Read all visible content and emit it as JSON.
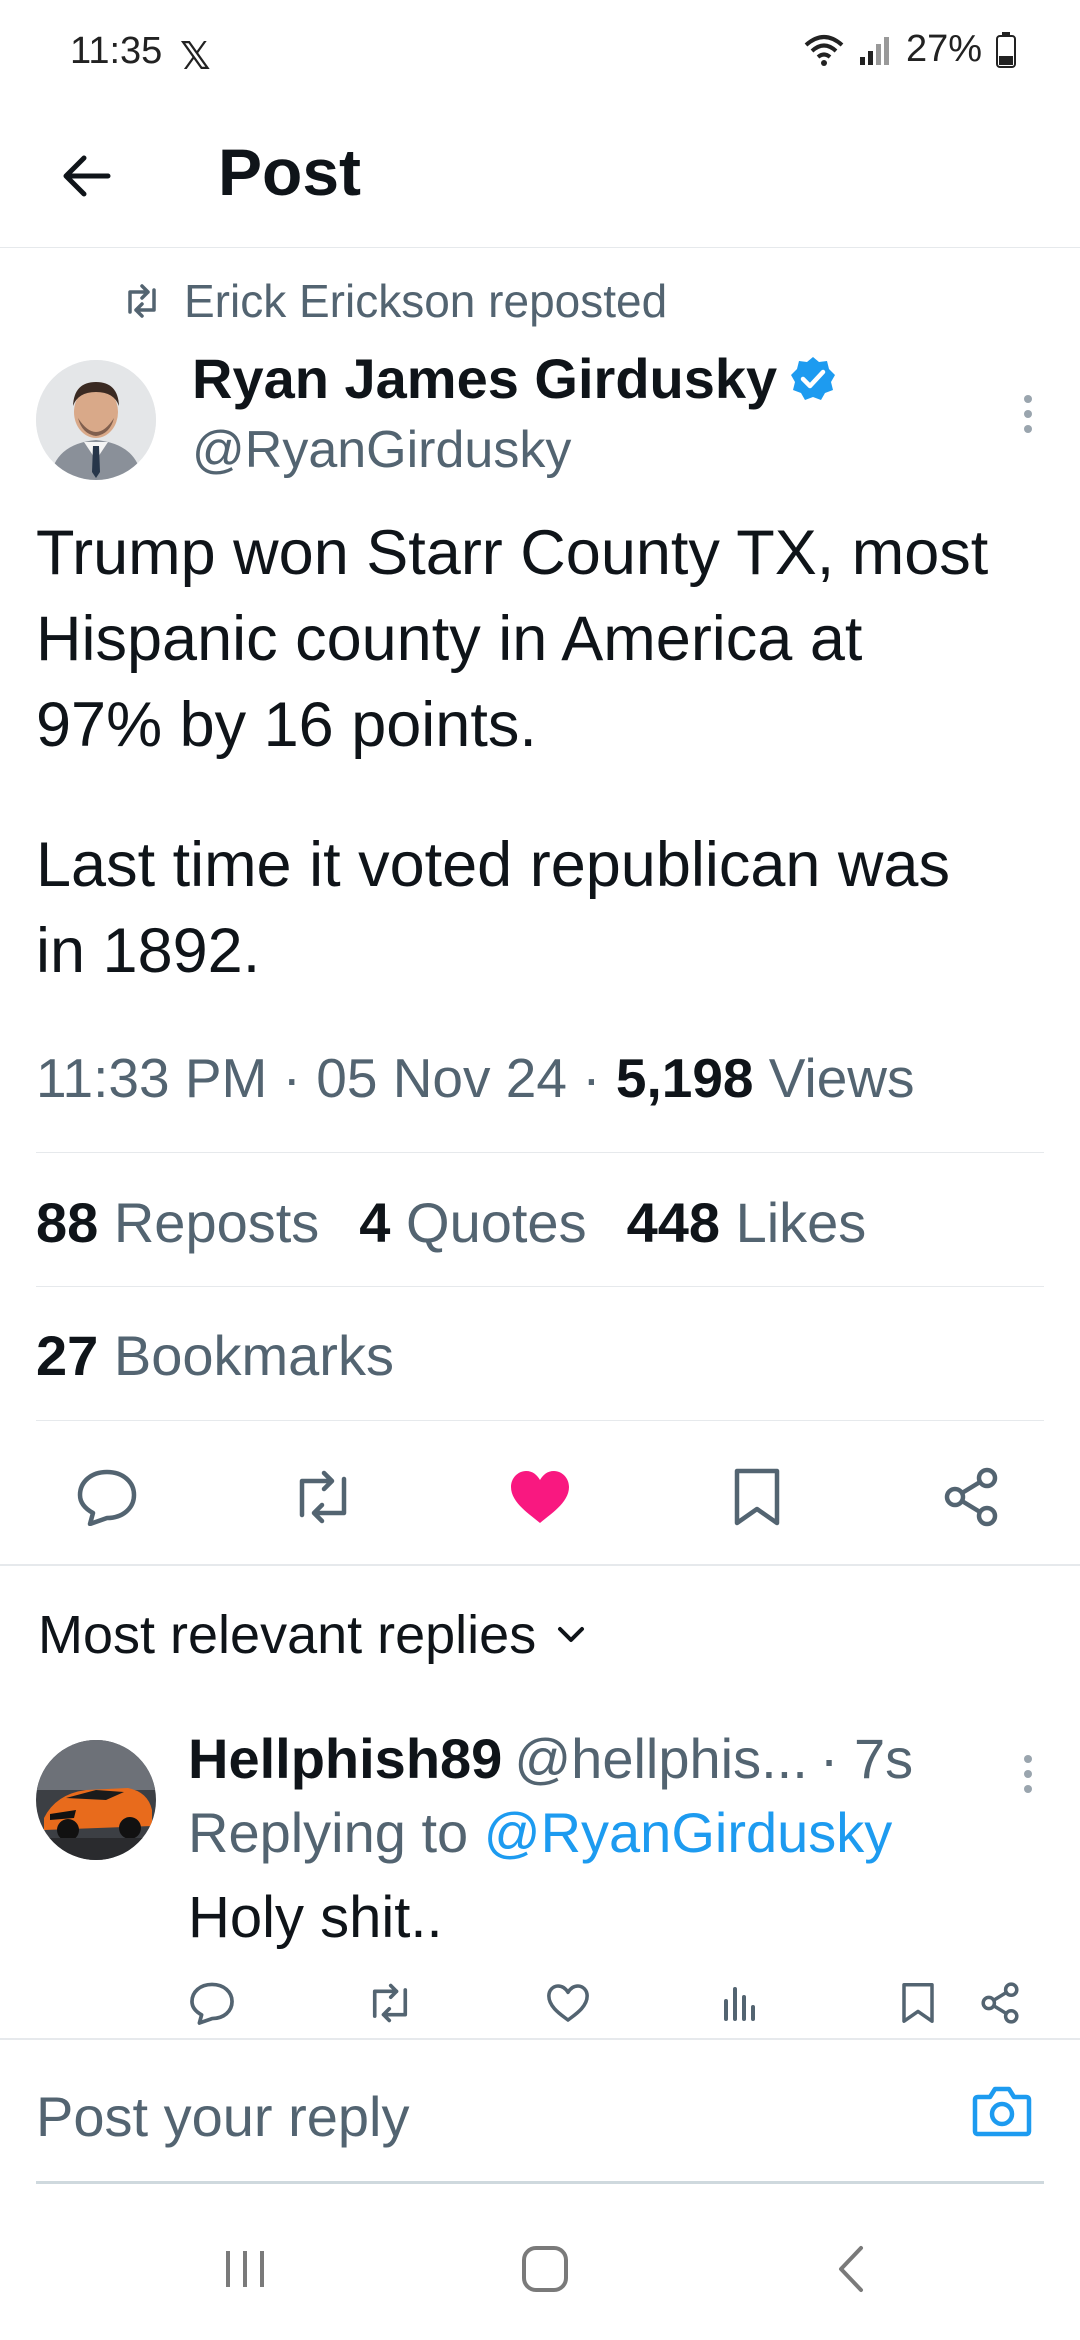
{
  "status_bar": {
    "time": "11:35",
    "app_badge": "𝕏",
    "battery": "27%"
  },
  "header": {
    "title": "Post"
  },
  "post": {
    "repost_label": "Erick Erickson reposted",
    "author_name": "Ryan James Girdusky",
    "author_handle": "@RyanGirdusky",
    "text_line1": "Trump won Starr County TX, most",
    "text_line2": "Hispanic county in America at",
    "text_line3": "97% by 16 points.",
    "text_line4": "Last time it voted republican was",
    "text_line5": "in 1892.",
    "time": "11:33 PM",
    "date": "05 Nov 24",
    "views_count": "5,198",
    "views_label": "Views",
    "sep": "·",
    "reposts_count": "88",
    "reposts_label": "Reposts",
    "quotes_count": "4",
    "quotes_label": "Quotes",
    "likes_count": "448",
    "likes_label": "Likes",
    "bookmarks_count": "27",
    "bookmarks_label": "Bookmarks",
    "liked": true
  },
  "replies": {
    "sort_label": "Most relevant replies",
    "items": [
      {
        "name": "Hellphish89",
        "handle": "@hellphis...",
        "age": "· 7s",
        "replying_prefix": "Replying to",
        "replying_to": "@RyanGirdusky",
        "text": "Holy shit.."
      }
    ]
  },
  "composer": {
    "placeholder": "Post your reply"
  },
  "icons": {
    "back": "back-arrow-icon",
    "repost": "repost-icon",
    "verified": "verified-badge-icon",
    "more": "more-vertical-icon",
    "reply": "reply-icon",
    "like": "heart-icon",
    "bookmark": "bookmark-icon",
    "share": "share-icon",
    "views": "views-chart-icon",
    "camera": "camera-icon",
    "chevron": "chevron-down-icon"
  },
  "colors": {
    "accent": "#1d9bf0",
    "like": "#f91880",
    "text": "#0f1419",
    "secondary": "#536471"
  }
}
